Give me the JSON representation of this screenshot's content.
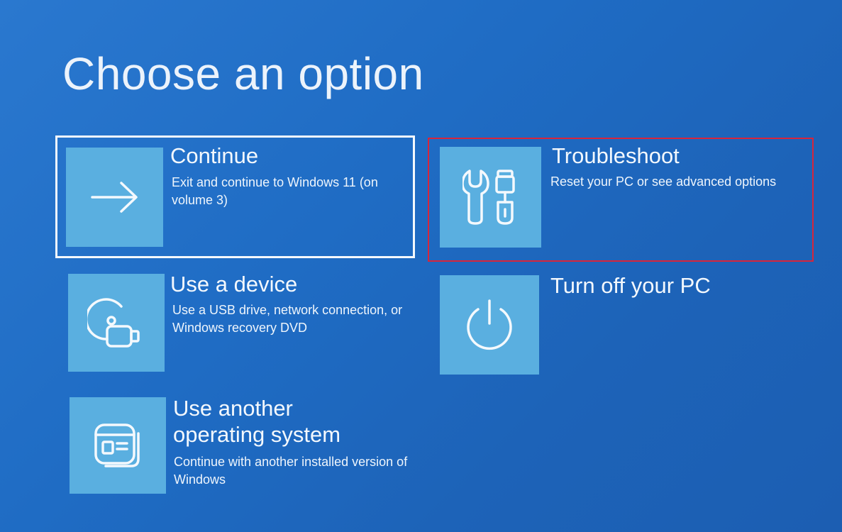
{
  "screen": {
    "title": "Choose an option"
  },
  "options": [
    {
      "id": "continue",
      "title": "Continue",
      "description": "Exit and continue to Windows 11 (on volume 3)",
      "icon": "arrow-right-icon",
      "focused": true
    },
    {
      "id": "troubleshoot",
      "title": "Troubleshoot",
      "description": "Reset your PC or see advanced options",
      "icon": "tools-icon",
      "highlighted": true
    },
    {
      "id": "use-a-device",
      "title": "Use a device",
      "description": "Use a USB drive, network connection, or Windows recovery DVD",
      "icon": "disc-usb-icon"
    },
    {
      "id": "turn-off",
      "title": "Turn off your PC",
      "description": "",
      "icon": "power-icon"
    },
    {
      "id": "use-another-os",
      "title": "Use another operating system",
      "description": "Continue with another installed version of Windows",
      "icon": "os-window-icon"
    }
  ],
  "colors": {
    "background": "#1f6cc4",
    "tile": "#5aafe0",
    "focus_ring": "#f4f8fc",
    "highlight_ring": "#d8253b"
  }
}
